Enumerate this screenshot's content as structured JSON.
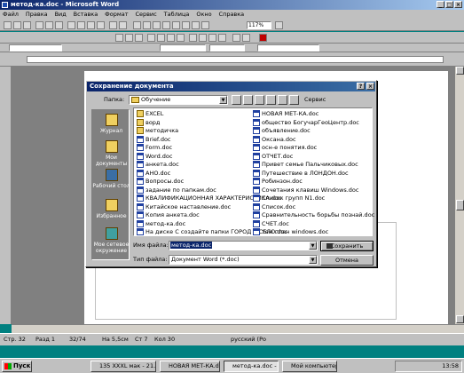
{
  "window": {
    "title": "метод-ка.doc - Microsoft Word"
  },
  "menu": [
    "Файл",
    "Правка",
    "Вид",
    "Вставка",
    "Формат",
    "Сервис",
    "Таблица",
    "Окно",
    "Справка"
  ],
  "toolbar": {
    "zoom": "117%"
  },
  "dialog": {
    "title": "Сохранение документа",
    "folder_label": "Папка:",
    "folder_value": "Обучение",
    "service_label": "Сервис",
    "places": [
      "Журнал",
      "Мои документы",
      "Рабочий стол",
      "Избранное",
      "Мое сетевое окружение"
    ],
    "files_left": [
      {
        "name": "EXCEL",
        "type": "folder"
      },
      {
        "name": "ворд",
        "type": "folder"
      },
      {
        "name": "методичка",
        "type": "folder"
      },
      {
        "name": "Brief.doc",
        "type": "doc"
      },
      {
        "name": "Form.doc",
        "type": "doc"
      },
      {
        "name": "Word.doc",
        "type": "doc"
      },
      {
        "name": "анкета.doc",
        "type": "doc"
      },
      {
        "name": "АНО.doc",
        "type": "doc"
      },
      {
        "name": "Вопросы.doc",
        "type": "doc"
      },
      {
        "name": "задание по папкам.doc",
        "type": "doc"
      },
      {
        "name": "КВАЛИФИКАЦИОННАЯ ХАРАКТЕРИСТИКА.doc",
        "type": "doc"
      },
      {
        "name": "Китайское наставление.doc",
        "type": "doc"
      },
      {
        "name": "Копия анкета.doc",
        "type": "doc"
      },
      {
        "name": "метод-ка.doc",
        "type": "doc"
      },
      {
        "name": "На диске С создайте папки ГОРОД и СЕЛО.doc",
        "type": "doc"
      }
    ],
    "files_right": [
      {
        "name": "НОВАЯ МЕТ-КА.doc",
        "type": "doc"
      },
      {
        "name": "общество БогучарГеоЦентр.doc",
        "type": "doc"
      },
      {
        "name": "объявление.doc",
        "type": "doc"
      },
      {
        "name": "Оксана.doc",
        "type": "doc"
      },
      {
        "name": "осн-е понятия.doc",
        "type": "doc"
      },
      {
        "name": "ОТЧЕТ.doc",
        "type": "doc"
      },
      {
        "name": "Привет семье Пальчиковых.doc",
        "type": "doc"
      },
      {
        "name": "Путешествие в ЛОНДОН.doc",
        "type": "doc"
      },
      {
        "name": "Робинзон.doc",
        "type": "doc"
      },
      {
        "name": "Сочетания клавиш Windows.doc",
        "type": "doc"
      },
      {
        "name": "Список групп N1.doc",
        "type": "doc"
      },
      {
        "name": "Список.doc",
        "type": "doc"
      },
      {
        "name": "Сравнительность борьбы познай.doc",
        "type": "doc"
      },
      {
        "name": "СЧЕТ.doc",
        "type": "doc"
      },
      {
        "name": "тем план windows.doc",
        "type": "doc"
      }
    ],
    "filename_label": "Имя файла:",
    "filename_value": "метод-ка.doc",
    "filetype_label": "Тип файла:",
    "filetype_value": "Документ Word (*.doc)",
    "save_button": "Сохранить",
    "cancel_button": "Отмена"
  },
  "status": {
    "page": "Стр. 32",
    "section": "Разд 1",
    "pages": "32/74",
    "at": "На 5,5см",
    "line": "Ст 7",
    "col": "Кол 30",
    "lang": "русский (Ро"
  },
  "taskbar": {
    "start": "Пуск",
    "tasks": [
      "135 XXXL мак - 21...",
      "НОВАЯ МЕТ-КА.doc",
      "метод-ка.doc - ...",
      "Мой компьютер"
    ],
    "clock": "13:58"
  }
}
